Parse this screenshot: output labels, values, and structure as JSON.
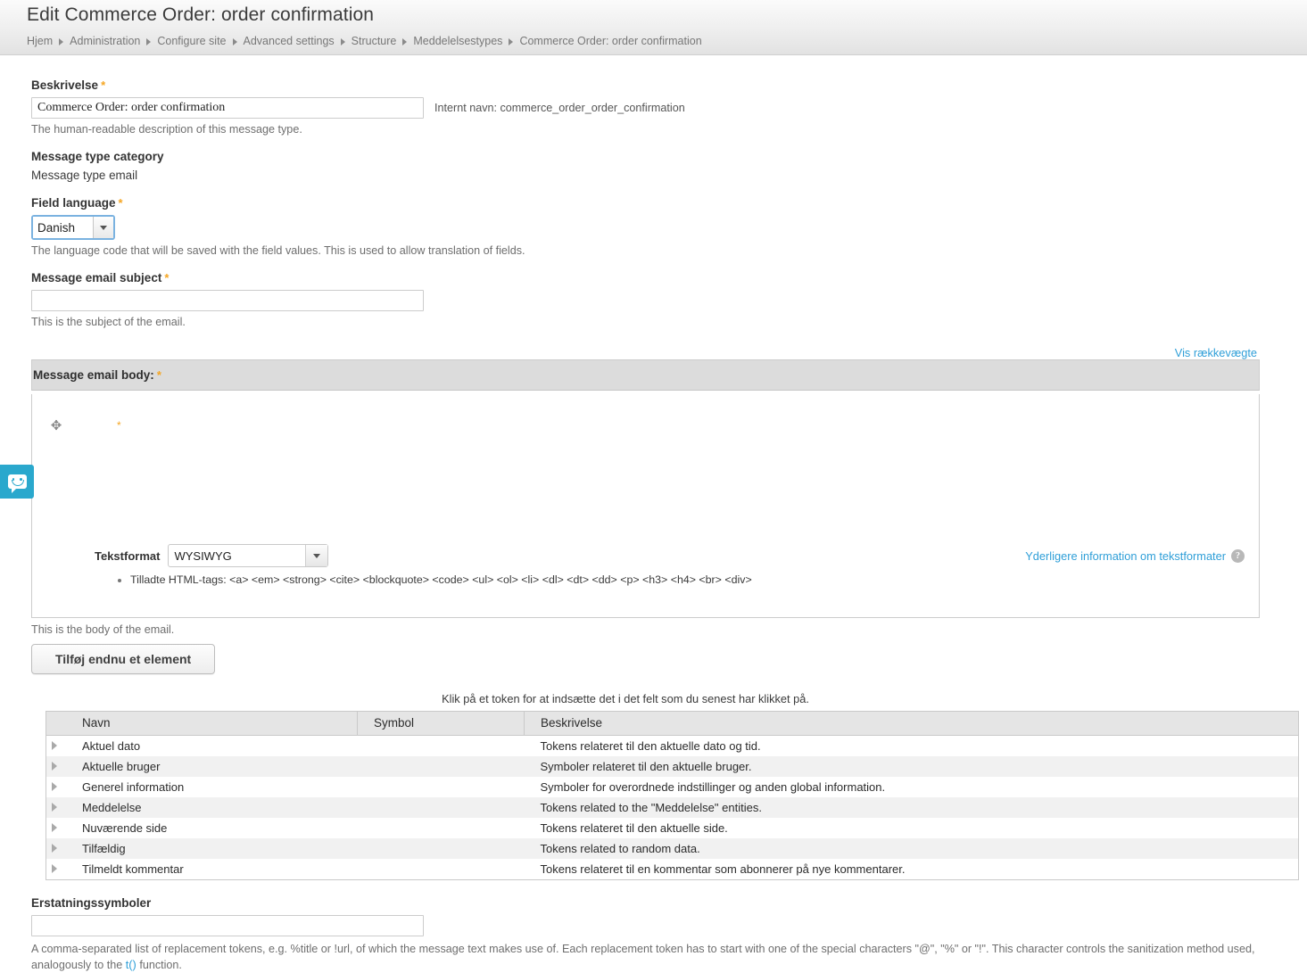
{
  "header": {
    "title": "Edit Commerce Order: order confirmation",
    "breadcrumb": [
      "Hjem",
      "Administration",
      "Configure site",
      "Advanced settings",
      "Structure",
      "Meddelelsestypes",
      "Commerce Order: order confirmation"
    ]
  },
  "colors": {
    "accent_link": "#2f9fd8",
    "required_star": "#f5a623",
    "feedback_tab": "#2aa8cd",
    "header_band": "#eeeeee",
    "group_header": "#dcdcdc"
  },
  "fields": {
    "description": {
      "label": "Beskrivelse",
      "required_marker": "*",
      "value": "Commerce Order: order confirmation",
      "placeholder": "",
      "internal_name": "Internt navn: commerce_order_order_confirmation",
      "help": "The human-readable description of this message type."
    },
    "message_type_category": {
      "label": "Message type category",
      "value": "Message type email"
    },
    "field_language": {
      "label": "Field language",
      "required_marker": "*",
      "selected": "Danish",
      "help": "The language code that will be saved with the field values. This is used to allow translation of fields."
    },
    "message_email_subject": {
      "label": "Message email subject",
      "required_marker": "*",
      "value": "",
      "placeholder": "",
      "help": "This is the subject of the email."
    },
    "message_email_body": {
      "weights_link": "Vis rækkevægte",
      "group_title": "Message email body:",
      "required_marker": "*",
      "inline_required_marker": "*",
      "drag_handle_icon": "✥",
      "text_format_label": "Tekstformat",
      "text_format_selected": "WYSIWYG",
      "allowed_tags": "Tilladte HTML-tags: <a> <em> <strong> <cite> <blockquote> <code> <ul> <ol> <li> <dl> <dt> <dd> <p> <h3> <h4> <br> <div>",
      "more_info_link": "Yderligere information om tekstformater",
      "help": "This is the body of the email."
    },
    "add_another": {
      "label": "Tilføj endnu et element"
    },
    "replacement_tokens": {
      "label": "Erstatningssymboler",
      "value": "",
      "placeholder": "",
      "help_part1": "A comma-separated list of replacement tokens, e.g. %title or !url, of which the message text makes use of. Each replacement token has to start with one of the special characters \"@\", \"%\" or \"!\". This character controls the sanitization method used, analogously to the ",
      "help_link": "t()",
      "help_part2": " function."
    }
  },
  "token_table": {
    "caption": "Klik på et token for at indsætte det i det felt som du senest har klikket på.",
    "columns": [
      "Navn",
      "Symbol",
      "Beskrivelse"
    ],
    "rows": [
      {
        "name": "Aktuel dato",
        "symbol": "",
        "description": "Tokens relateret til den aktuelle dato og tid."
      },
      {
        "name": "Aktuelle bruger",
        "symbol": "",
        "description": "Symboler relateret til den aktuelle bruger."
      },
      {
        "name": "Generel information",
        "symbol": "",
        "description": "Symboler for overordnede indstillinger og anden global information."
      },
      {
        "name": "Meddelelse",
        "symbol": "",
        "description": "Tokens related to the \"Meddelelse\" entities."
      },
      {
        "name": "Nuværende side",
        "symbol": "",
        "description": "Tokens relateret til den aktuelle side."
      },
      {
        "name": "Tilfældig",
        "symbol": "",
        "description": "Tokens related to random data."
      },
      {
        "name": "Tilmeldt kommentar",
        "symbol": "",
        "description": "Tokens relateret til en kommentar som abonnerer på nye kommentarer."
      }
    ]
  },
  "feedback_tab": {
    "icon": "chat-bubble-icon"
  }
}
